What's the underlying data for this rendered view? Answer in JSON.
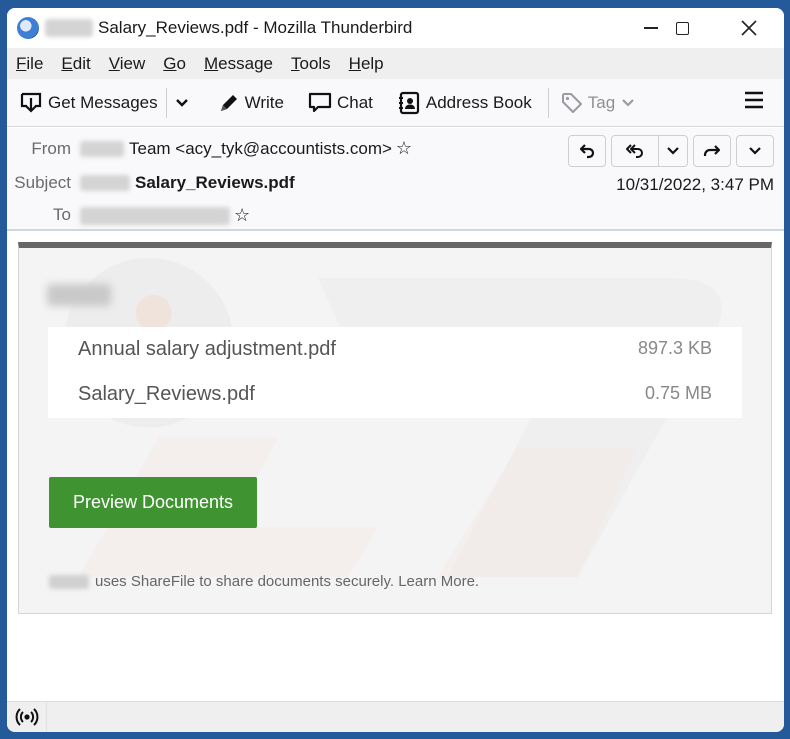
{
  "window": {
    "title": "Salary_Reviews.pdf - Mozilla Thunderbird",
    "controls": {
      "minimize": "minimize",
      "maximize": "maximize",
      "close": "close"
    }
  },
  "menubar": {
    "items": [
      {
        "label_ul": "F",
        "label_rest": "ile"
      },
      {
        "label_ul": "E",
        "label_rest": "dit"
      },
      {
        "label_ul": "V",
        "label_rest": "iew"
      },
      {
        "label_ul": "G",
        "label_rest": "o"
      },
      {
        "label_ul": "M",
        "label_rest": "essage"
      },
      {
        "label_ul": "T",
        "label_rest": "ools"
      },
      {
        "label_ul": "H",
        "label_rest": "elp"
      }
    ]
  },
  "toolbar": {
    "get_messages": "Get Messages",
    "write": "Write",
    "chat": "Chat",
    "address_book": "Address Book",
    "tag": "Tag"
  },
  "header": {
    "from_label": "From",
    "from_value": "Team <acy_tyk@accountists.com>",
    "subject_label": "Subject",
    "subject_value": "Salary_Reviews.pdf",
    "to_label": "To",
    "date": "10/31/2022, 3:47 PM"
  },
  "message": {
    "files": [
      {
        "name": "Annual salary adjustment.pdf",
        "size": "897.3 KB"
      },
      {
        "name": "Salary_Reviews.pdf",
        "size": "0.75 MB"
      }
    ],
    "button_label": "Preview Documents",
    "button_color": "#3f9431",
    "footer": "uses ShareFile to share documents securely. Learn More."
  },
  "colors": {
    "frame": "#245a9a",
    "card_top_border": "#666666"
  }
}
